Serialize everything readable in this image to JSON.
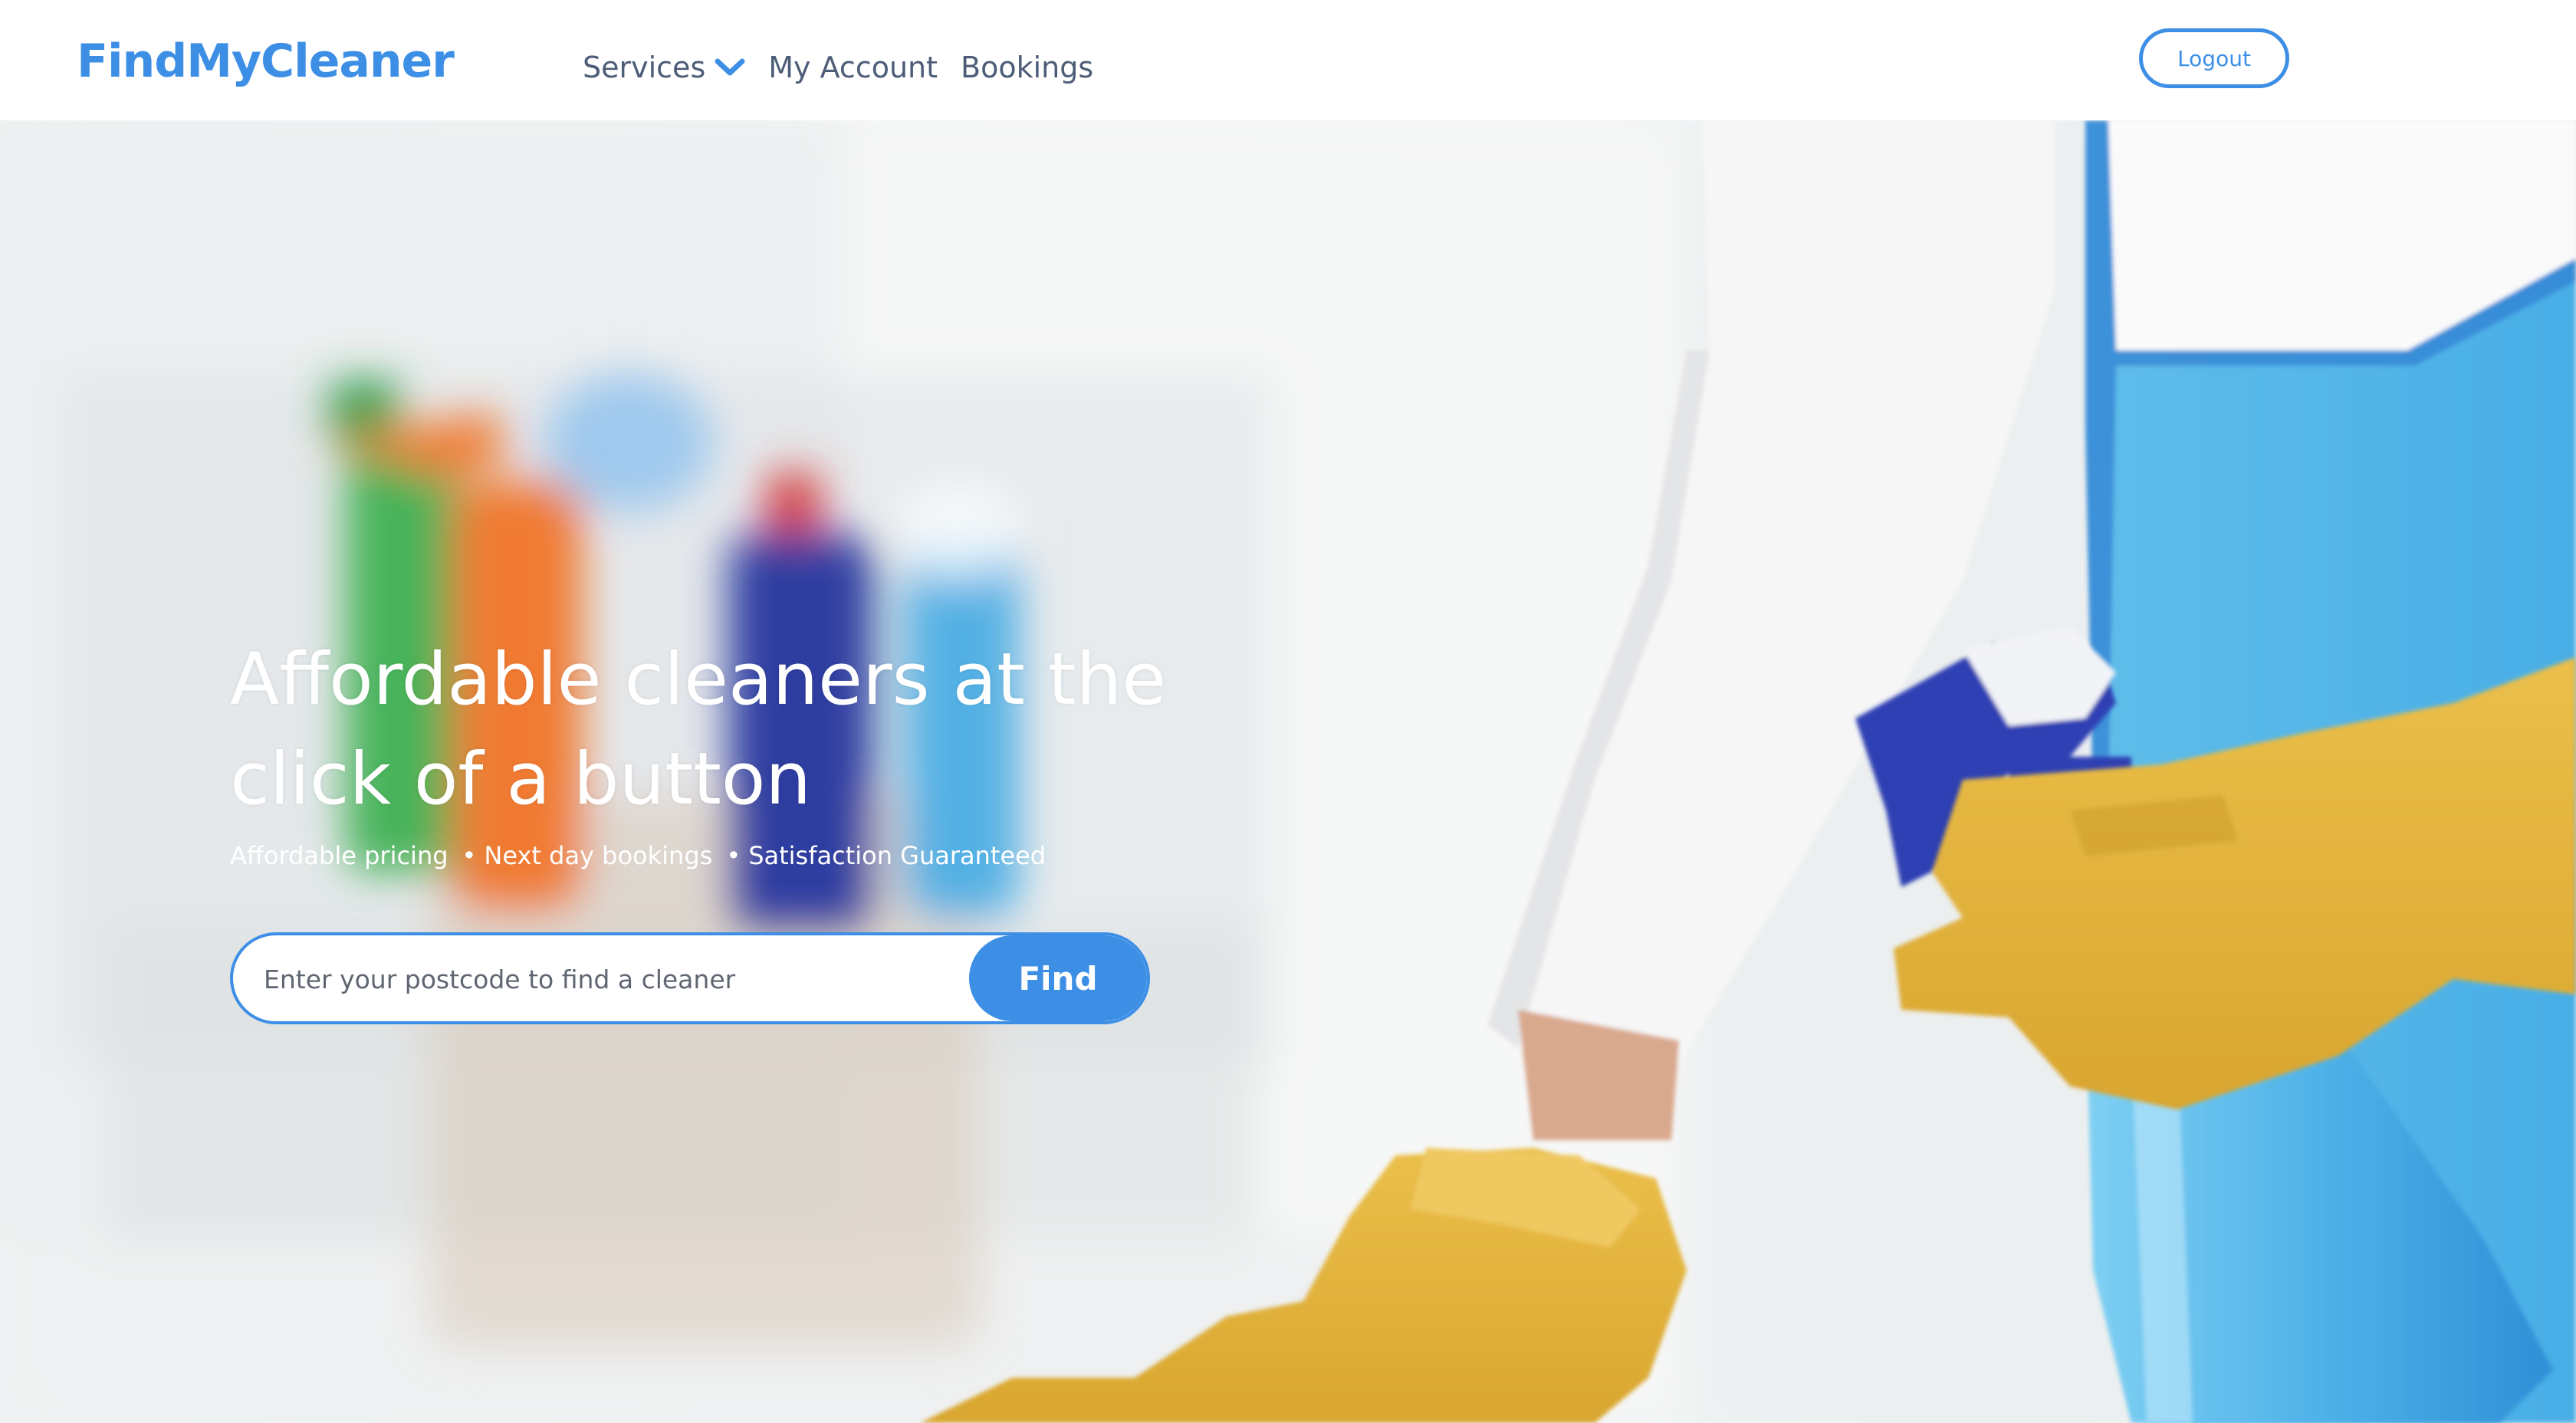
{
  "brand": {
    "name": "FindMyCleaner"
  },
  "nav": {
    "items": [
      {
        "label": "Services",
        "has_dropdown": true,
        "icon": "chevron-down-icon"
      },
      {
        "label": "My Account",
        "has_dropdown": false
      },
      {
        "label": "Bookings",
        "has_dropdown": false
      }
    ],
    "logout_label": "Logout"
  },
  "hero": {
    "title": "Affordable cleaners at the click of a button",
    "features": [
      "Affordable pricing",
      "Next day bookings",
      "Satisfaction Guaranteed"
    ],
    "feature_separator": "•",
    "search": {
      "value": "",
      "placeholder": "Enter your postcode to find a cleaner",
      "button_label": "Find"
    }
  },
  "colors": {
    "accent": "#3d8fe6",
    "nav_text": "#4d5d78",
    "hero_text": "#ffffff",
    "glove_yellow": "#e2b33c",
    "apron_blue": "#55b6ea"
  }
}
